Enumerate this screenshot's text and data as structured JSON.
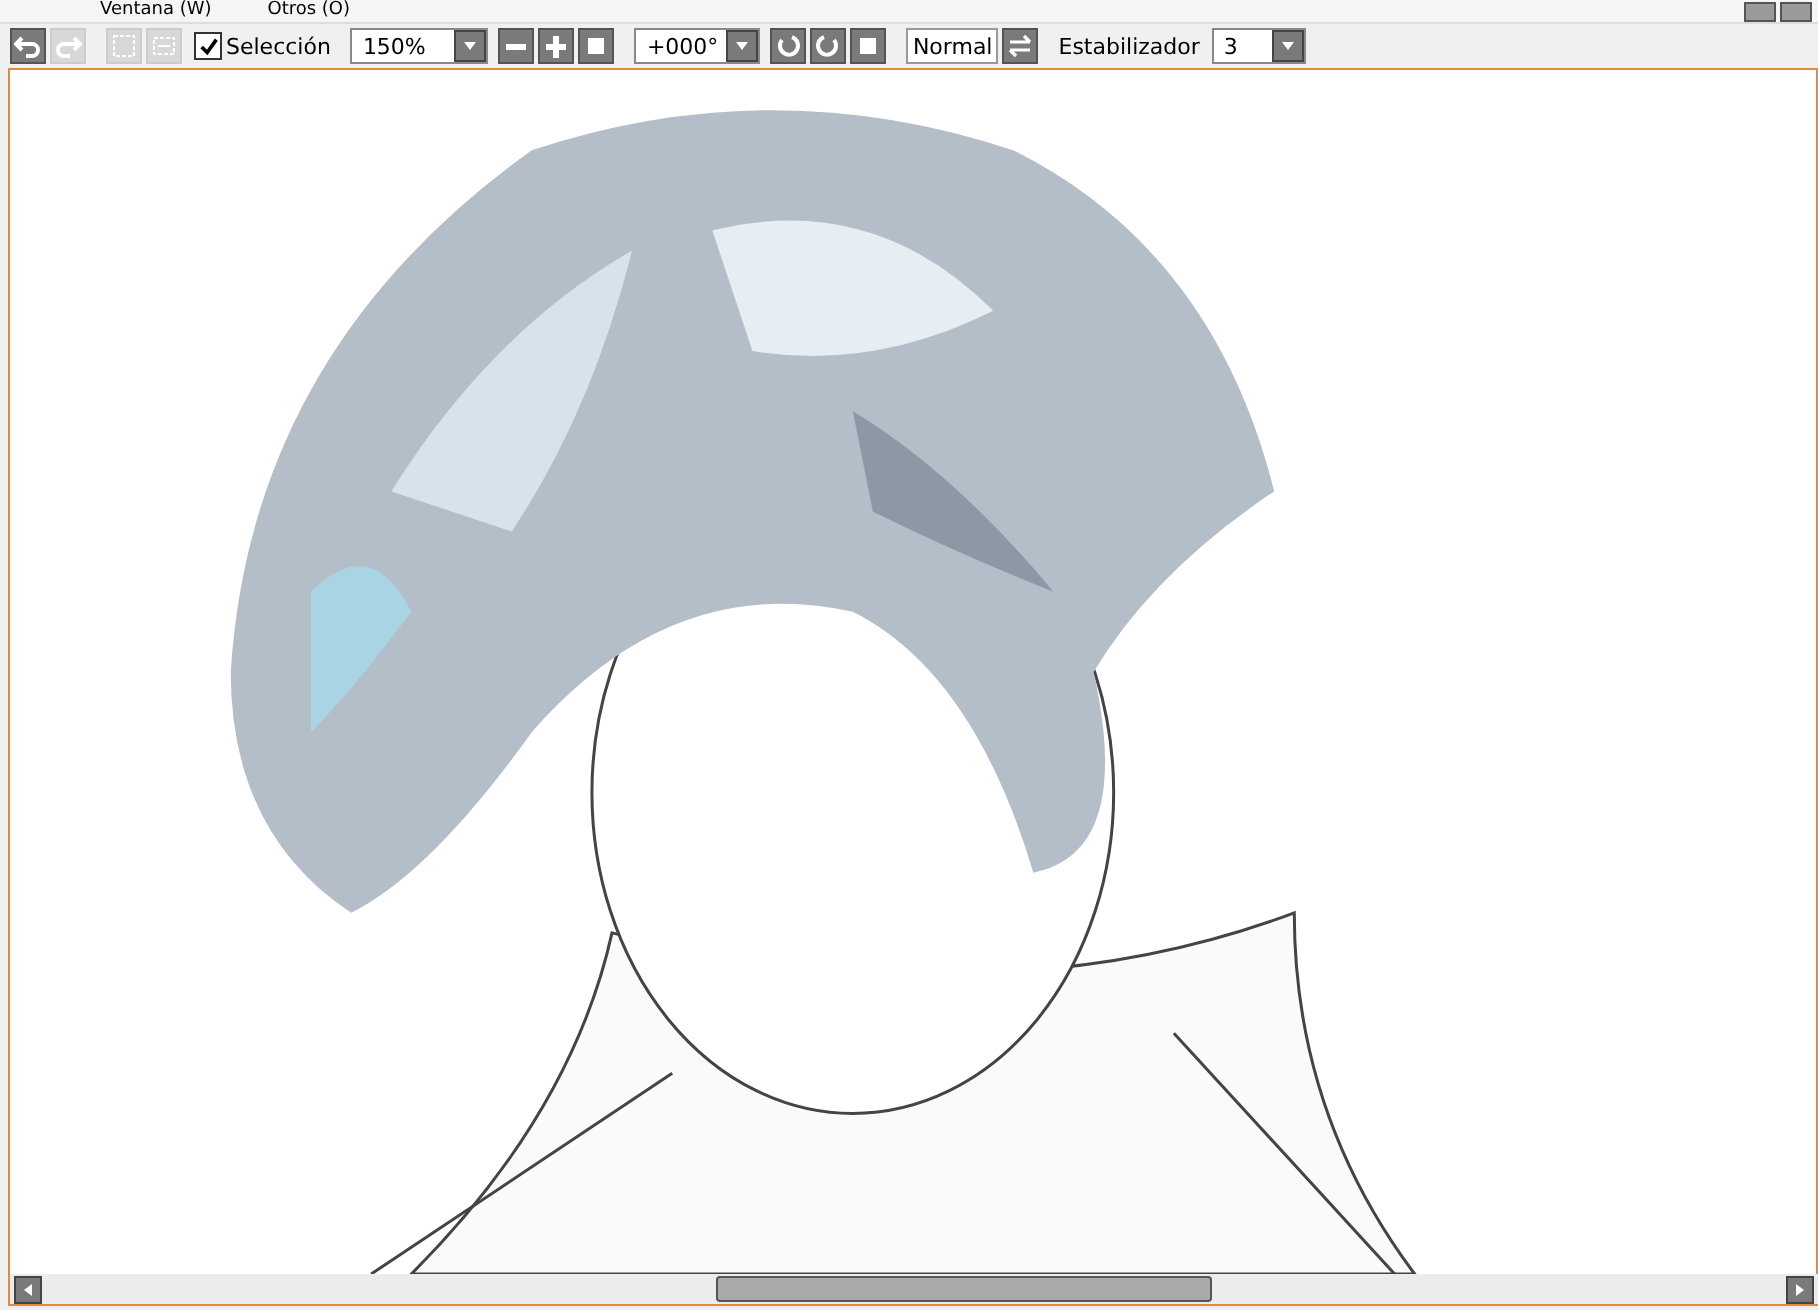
{
  "menu": [
    {
      "label": "Ventana (W)"
    },
    {
      "label": "Otros (O)"
    }
  ],
  "toolbar": {
    "undo": {
      "disabled": false
    },
    "redo": {
      "disabled": true
    },
    "crop": {
      "disabled": true
    },
    "deselect": {
      "disabled": true
    },
    "selection_checkbox": {
      "label": "Selección",
      "checked": true
    },
    "zoom": {
      "value": "150%"
    },
    "rotation": {
      "value": "+000°"
    },
    "blend_mode": {
      "label": "Normal"
    },
    "stabilizer": {
      "label": "Estabilizador",
      "value": "3"
    }
  }
}
